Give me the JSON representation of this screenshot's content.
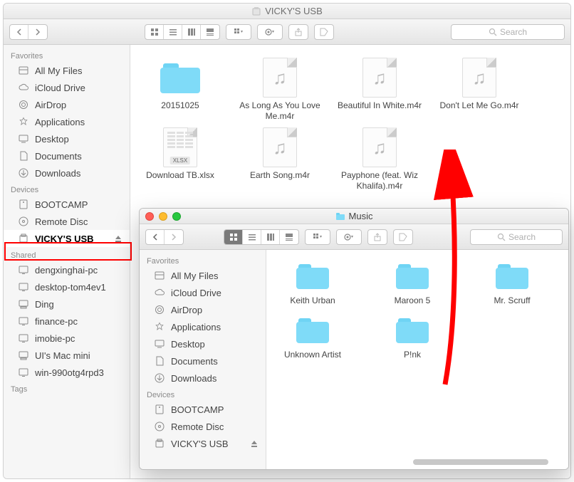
{
  "window_main": {
    "title": "VICKY'S USB",
    "search_placeholder": "Search",
    "sidebar": {
      "sections": [
        {
          "heading": "Favorites",
          "items": [
            {
              "icon": "all-my-files",
              "label": "All My Files"
            },
            {
              "icon": "icloud",
              "label": "iCloud Drive"
            },
            {
              "icon": "airdrop",
              "label": "AirDrop"
            },
            {
              "icon": "applications",
              "label": "Applications"
            },
            {
              "icon": "desktop",
              "label": "Desktop"
            },
            {
              "icon": "documents",
              "label": "Documents"
            },
            {
              "icon": "downloads",
              "label": "Downloads"
            }
          ]
        },
        {
          "heading": "Devices",
          "items": [
            {
              "icon": "disk",
              "label": "BOOTCAMP"
            },
            {
              "icon": "disc",
              "label": "Remote Disc"
            },
            {
              "icon": "usb",
              "label": "VICKY'S USB",
              "selected": true,
              "eject": true
            }
          ]
        },
        {
          "heading": "Shared",
          "items": [
            {
              "icon": "pc",
              "label": "dengxinghai-pc"
            },
            {
              "icon": "pc",
              "label": "desktop-tom4ev1"
            },
            {
              "icon": "mac",
              "label": "Ding"
            },
            {
              "icon": "pc",
              "label": "finance-pc"
            },
            {
              "icon": "pc",
              "label": "imobie-pc"
            },
            {
              "icon": "mac",
              "label": "UI's Mac mini"
            },
            {
              "icon": "pc",
              "label": "win-990otg4rpd3"
            }
          ]
        },
        {
          "heading": "Tags",
          "items": []
        }
      ]
    },
    "items": [
      {
        "type": "folder",
        "name": "20151025"
      },
      {
        "type": "audio",
        "name": "As Long As You Love Me.m4r"
      },
      {
        "type": "audio",
        "name": "Beautiful In White.m4r"
      },
      {
        "type": "audio",
        "name": "Don't Let Me Go.m4r"
      },
      {
        "type": "xlsx",
        "name": "Download TB.xlsx",
        "badge": "XLSX"
      },
      {
        "type": "audio",
        "name": "Earth Song.m4r"
      },
      {
        "type": "audio",
        "name": "Payphone (feat. Wiz Khalifa).m4r"
      }
    ]
  },
  "window_overlay": {
    "title": "Music",
    "search_placeholder": "Search",
    "sidebar": {
      "sections": [
        {
          "heading": "Favorites",
          "items": [
            {
              "icon": "all-my-files",
              "label": "All My Files"
            },
            {
              "icon": "icloud",
              "label": "iCloud Drive"
            },
            {
              "icon": "airdrop",
              "label": "AirDrop"
            },
            {
              "icon": "applications",
              "label": "Applications"
            },
            {
              "icon": "desktop",
              "label": "Desktop"
            },
            {
              "icon": "documents",
              "label": "Documents"
            },
            {
              "icon": "downloads",
              "label": "Downloads"
            }
          ]
        },
        {
          "heading": "Devices",
          "items": [
            {
              "icon": "disk",
              "label": "BOOTCAMP"
            },
            {
              "icon": "disc",
              "label": "Remote Disc"
            },
            {
              "icon": "usb",
              "label": "VICKY'S USB",
              "eject": true
            }
          ]
        }
      ]
    },
    "items": [
      {
        "type": "folder",
        "name": "Keith Urban"
      },
      {
        "type": "folder",
        "name": "Maroon 5"
      },
      {
        "type": "folder",
        "name": "Mr. Scruff"
      },
      {
        "type": "folder",
        "name": "Unknown Artist"
      },
      {
        "type": "folder",
        "name": "P!nk"
      }
    ]
  },
  "annotations": {
    "redbox": {
      "target": "VICKY'S USB sidebar row"
    },
    "arrow": {
      "color": "#ff0000",
      "from": "overlay content",
      "to": "main-window upper area"
    }
  }
}
